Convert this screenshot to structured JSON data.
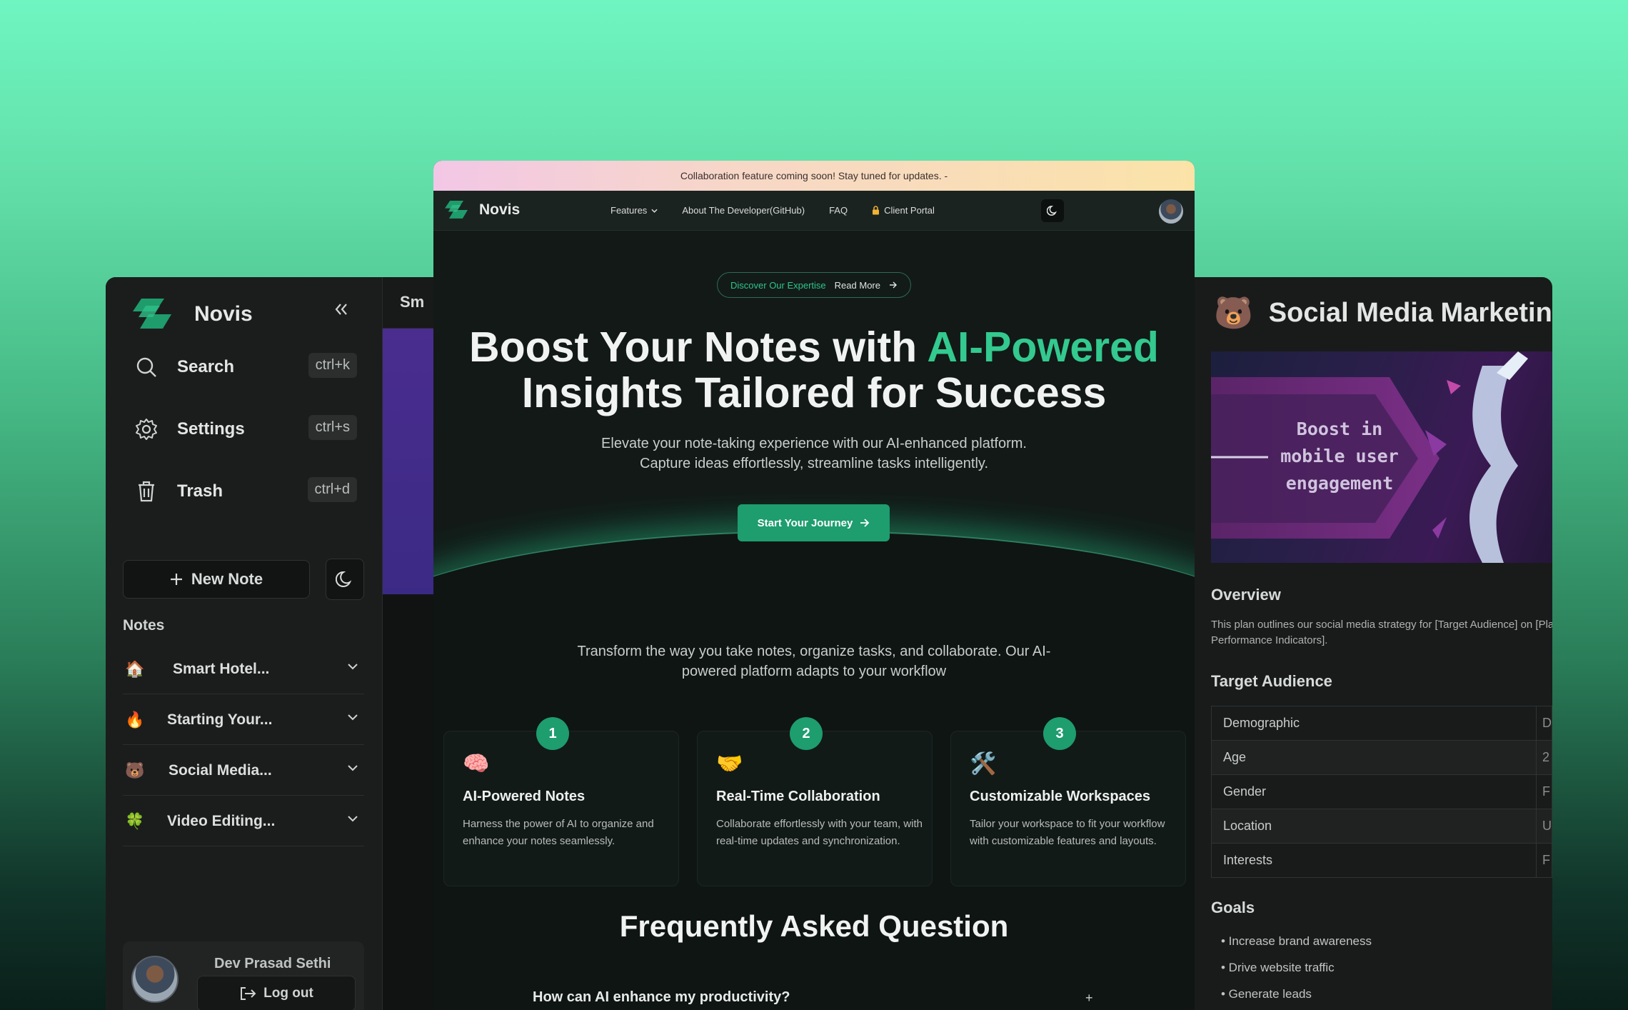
{
  "left_app": {
    "brand": "Novis",
    "collapse_icon": "double-chevron-left-icon",
    "menu": [
      {
        "label": "Search",
        "shortcut": "ctrl+k",
        "icon": "search-icon"
      },
      {
        "label": "Settings",
        "shortcut": "ctrl+s",
        "icon": "gear-icon"
      },
      {
        "label": "Trash",
        "shortcut": "ctrl+d",
        "icon": "trash-icon"
      }
    ],
    "new_note_label": "New Note",
    "notes_heading": "Notes",
    "notes": [
      {
        "emoji": "🏠",
        "title": "Smart Hotel..."
      },
      {
        "emoji": "🔥",
        "title": "Starting Your..."
      },
      {
        "emoji": "🐻",
        "title": "Social Media..."
      },
      {
        "emoji": "🍀",
        "title": "Video Editing..."
      }
    ],
    "user_name": "Dev Prasad Sethi",
    "logout_label": "Log out",
    "editor_tab_fragment": "Sm"
  },
  "center_app": {
    "announcement": "Collaboration feature coming soon! Stay tuned for updates. -",
    "brand": "Novis",
    "nav": {
      "features": "Features",
      "about": "About The Developer(GitHub)",
      "faq": "FAQ",
      "client_portal": "Client Portal"
    },
    "pill": {
      "lead": "Discover Our Expertise",
      "link": "Read More"
    },
    "hero": {
      "title_part1": "Boost Your Notes with ",
      "title_accent": "AI-Powered",
      "title_part2": "Insights Tailored for Success",
      "subtitle_line1": "Elevate your note-taking experience with our AI-enhanced platform.",
      "subtitle_line2": "Capture ideas effortlessly, streamline tasks intelligently.",
      "cta": "Start Your Journey"
    },
    "intro_line1": "Transform the way you take notes, organize tasks, and collaborate. Our AI-",
    "intro_line2": "powered platform adapts to your workflow",
    "features": [
      {
        "step": "1",
        "emoji": "🧠",
        "title": "AI-Powered Notes",
        "desc": "Harness the power of AI to organize and enhance your notes seamlessly."
      },
      {
        "step": "2",
        "emoji": "🤝",
        "title": "Real-Time Collaboration",
        "desc": "Collaborate effortlessly with your team, with real-time updates and synchronization."
      },
      {
        "step": "3",
        "emoji": "🛠️",
        "title": "Customizable Workspaces",
        "desc": "Tailor your workspace to fit your workflow with customizable features and layouts."
      }
    ],
    "faq_title": "Frequently Asked Question",
    "faq_first_question": "How can AI enhance my productivity?",
    "faq_toggle": "+",
    "accent_color": "#1e9d6f"
  },
  "right_app": {
    "emoji": "🐻",
    "title": "Social Media Marketin",
    "banner_text_line1": "Boost in",
    "banner_text_line2": "mobile user",
    "banner_text_line3": "engagement",
    "overview_heading": "Overview",
    "overview_line1": "This plan outlines our social media strategy for [Target Audience] on [Pla",
    "overview_line2": "Performance Indicators].",
    "target_heading": "Target Audience",
    "target_rows": [
      {
        "label": "Demographic",
        "value": "D"
      },
      {
        "label": "Age",
        "value": "2"
      },
      {
        "label": "Gender",
        "value": "F"
      },
      {
        "label": "Location",
        "value": "U"
      },
      {
        "label": "Interests",
        "value": "F"
      }
    ],
    "goals_heading": "Goals",
    "goals": [
      "• Increase brand awareness",
      "• Drive website traffic",
      "• Generate leads"
    ]
  }
}
